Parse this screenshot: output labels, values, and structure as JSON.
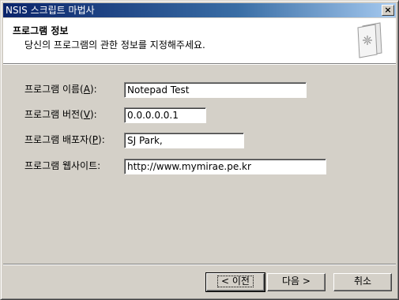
{
  "window": {
    "title": "NSIS 스크립트 마법사",
    "close_glyph": "×"
  },
  "header": {
    "title": "프로그램 정보",
    "subtitle": "당신의 프로그램의 관한 정보를 지정해주세요.",
    "icon": "wizard-book-icon"
  },
  "fields": [
    {
      "label_prefix": "프로그램 이름(",
      "accel": "A",
      "label_suffix": "):",
      "value": "Notepad Test"
    },
    {
      "label_prefix": "프로그램 버전(",
      "accel": "V",
      "label_suffix": "):",
      "value": "0.0.0.0.0.1"
    },
    {
      "label_prefix": "프로그램 배포자(",
      "accel": "P",
      "label_suffix": "):",
      "value": "SJ Park,"
    },
    {
      "label_prefix": "프로그램 웹사이트:",
      "accel": "",
      "label_suffix": "",
      "value": "http://www.mymirae.pe.kr"
    }
  ],
  "buttons": {
    "back": "< 이전",
    "next": "다음 >",
    "cancel": "취소"
  },
  "colors": {
    "titlebar_start": "#0a246a",
    "titlebar_end": "#a6caf0",
    "face": "#d4d0c8"
  }
}
